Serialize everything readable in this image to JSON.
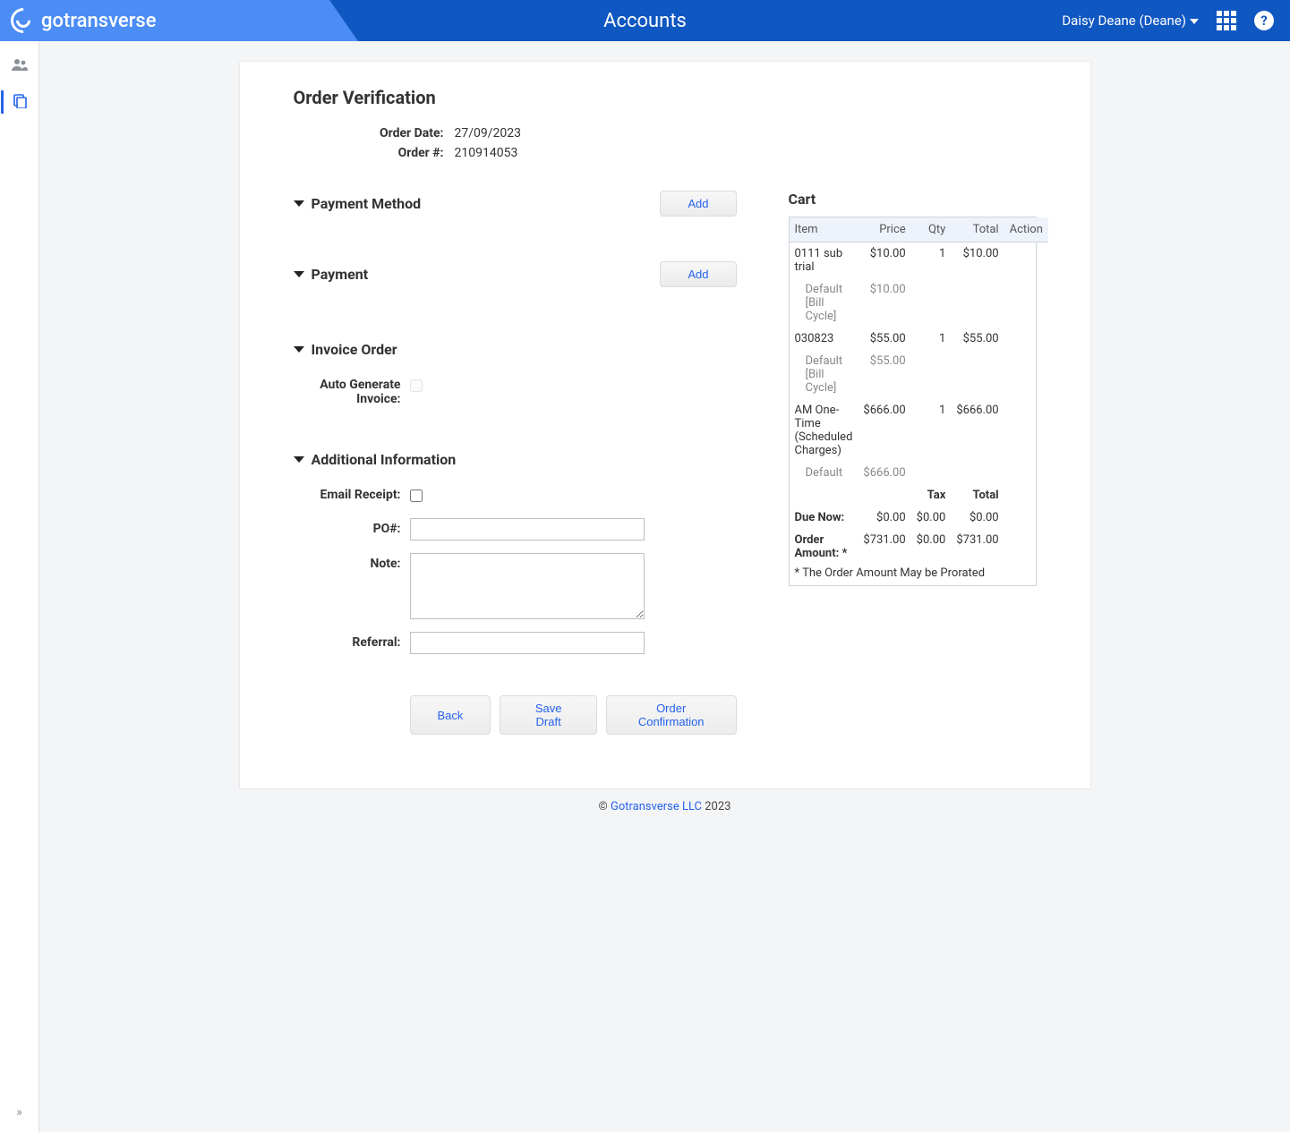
{
  "header": {
    "brand": "gotransverse",
    "title": "Accounts",
    "user": "Daisy Deane (Deane)"
  },
  "page": {
    "title": "Order Verification",
    "order_date_label": "Order Date:",
    "order_date": "27/09/2023",
    "order_num_label": "Order #:",
    "order_num": "210914053"
  },
  "sections": {
    "payment_method": {
      "title": "Payment Method",
      "add": "Add"
    },
    "payment": {
      "title": "Payment",
      "add": "Add"
    },
    "invoice_order": {
      "title": "Invoice Order",
      "auto_generate_label": "Auto Generate Invoice:"
    },
    "additional": {
      "title": "Additional Information",
      "email_receipt_label": "Email Receipt:",
      "po_label": "PO#:",
      "note_label": "Note:",
      "referral_label": "Referral:"
    }
  },
  "actions": {
    "back": "Back",
    "save_draft": "Save Draft",
    "confirm": "Order Confirmation"
  },
  "cart": {
    "title": "Cart",
    "headers": {
      "item": "Item",
      "price": "Price",
      "qty": "Qty",
      "total": "Total",
      "action": "Action"
    },
    "rows": [
      {
        "item": "0111 sub trial",
        "price": "$10.00",
        "qty": "1",
        "total": "$10.00",
        "sub": {
          "name": "Default [Bill Cycle]",
          "price": "$10.00"
        }
      },
      {
        "item": "030823",
        "price": "$55.00",
        "qty": "1",
        "total": "$55.00",
        "sub": {
          "name": "Default [Bill Cycle]",
          "price": "$55.00"
        }
      },
      {
        "item": "AM One-Time (Scheduled Charges)",
        "price": "$666.00",
        "qty": "1",
        "total": "$666.00",
        "sub": {
          "name": "Default",
          "price": "$666.00"
        }
      }
    ],
    "summary_headers": {
      "tax": "Tax",
      "total": "Total"
    },
    "due_now": {
      "label": "Due Now:",
      "amount": "$0.00",
      "tax": "$0.00",
      "total": "$0.00"
    },
    "order_amount": {
      "label": "Order Amount: *",
      "amount": "$731.00",
      "tax": "$0.00",
      "total": "$731.00"
    },
    "footnote": "* The Order Amount May be Prorated"
  },
  "footer": {
    "copyright_symbol": "©",
    "link": "Gotransverse LLC",
    "year": "2023"
  }
}
